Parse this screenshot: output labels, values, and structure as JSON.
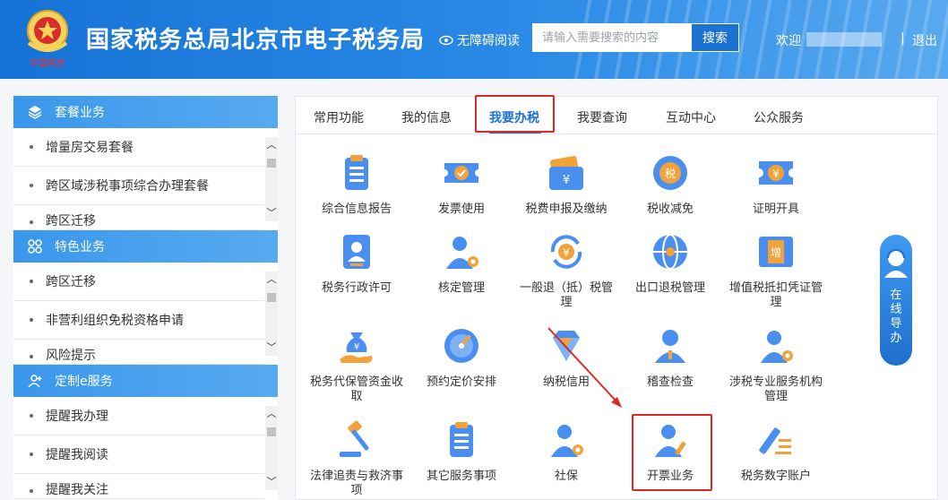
{
  "header": {
    "title": "国家税务总局北京市电子税务局",
    "emblem_caption": "中国税务",
    "accessibility_label": "无障碍阅读",
    "search": {
      "placeholder": "请输入需要搜索的内容",
      "value": "",
      "button_label": "搜索"
    },
    "welcome": "欢迎",
    "divider": "|",
    "logout_label": "退出",
    "colors": {
      "bar": "#1673d6",
      "bar_light": "#58a9ef"
    }
  },
  "sidebar": {
    "sections": [
      {
        "title": "套餐业务",
        "icon": "layers-icon",
        "items": [
          "增量房交易套餐",
          "跨区域涉税事项综合办理套餐",
          "跨区迁移"
        ]
      },
      {
        "title": "特色业务",
        "icon": "apps-icon",
        "items": [
          "跨区迁移",
          "非营利组织免税资格申请",
          "风险提示"
        ]
      },
      {
        "title": "定制e服务",
        "icon": "user-plus-icon",
        "items": [
          "提醒我办理",
          "提醒我阅读",
          "提醒我关注"
        ]
      }
    ]
  },
  "main": {
    "tabs": [
      "常用功能",
      "我的信息",
      "我要办税",
      "我要查询",
      "互动中心",
      "公众服务"
    ],
    "active_tab": "我要办税",
    "tiles": [
      {
        "label": "综合信息报告",
        "icon": "document-list-icon"
      },
      {
        "label": "发票使用",
        "icon": "ticket-check-icon"
      },
      {
        "label": "税费申报及缴纳",
        "icon": "yen-wallet-icon"
      },
      {
        "label": "税收减免",
        "icon": "tax-coin-icon"
      },
      {
        "label": "证明开具",
        "icon": "yen-ticket-icon"
      },
      {
        "label": "税务行政许可",
        "icon": "id-card-icon"
      },
      {
        "label": "核定管理",
        "icon": "user-gear-icon"
      },
      {
        "label": "一般退（抵）税管理",
        "icon": "yen-refresh-icon"
      },
      {
        "label": "出口退税管理",
        "icon": "globe-icon"
      },
      {
        "label": "增值税抵扣凭证管理",
        "icon": "vat-ticket-icon"
      },
      {
        "label": "税务代保管资金收取",
        "icon": "money-bag-hand-icon"
      },
      {
        "label": "预约定价安排",
        "icon": "gauge-icon"
      },
      {
        "label": "纳税信用",
        "icon": "diamond-icon"
      },
      {
        "label": "稽查检查",
        "icon": "user-icon"
      },
      {
        "label": "涉税专业服务机构管理",
        "icon": "user-gear-icon"
      },
      {
        "label": "法律追责与救济事项",
        "icon": "gavel-icon"
      },
      {
        "label": "其它服务事项",
        "icon": "document-list-icon"
      },
      {
        "label": "社保",
        "icon": "user-gear-icon"
      },
      {
        "label": "开票业务",
        "icon": "user-pen-icon"
      },
      {
        "label": "税务数字账户",
        "icon": "pen-lines-icon"
      }
    ]
  },
  "guide": {
    "label": "在线导办",
    "chars": [
      "在",
      "线",
      "导",
      "办"
    ]
  },
  "annotation": {
    "color": "#e02727"
  }
}
